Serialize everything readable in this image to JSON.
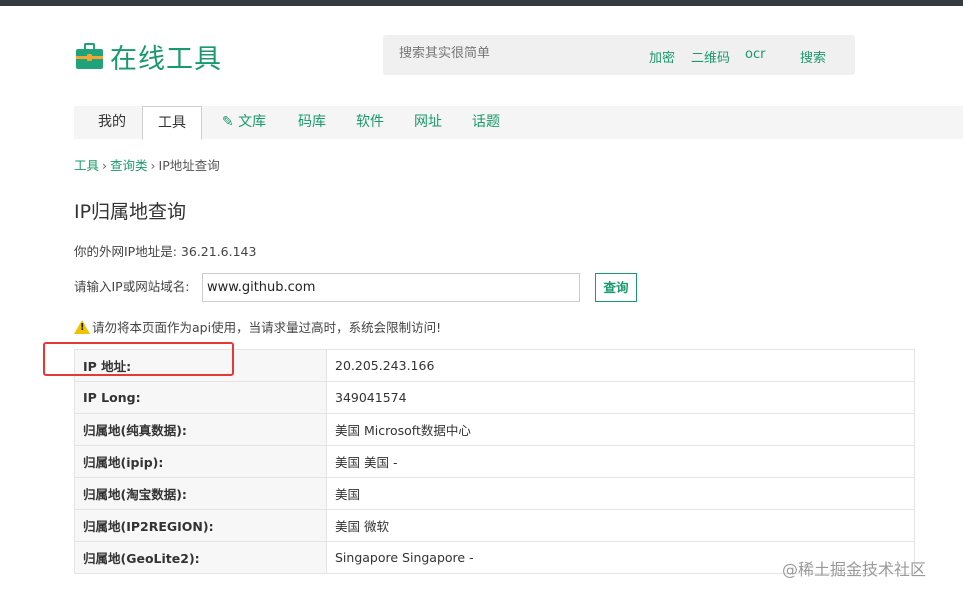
{
  "header": {
    "logo_text": "在线工具",
    "search_placeholder": "搜索其实很简单",
    "search_tags": [
      "加密",
      "二维码",
      "ocr"
    ],
    "search_button": "搜索"
  },
  "nav": {
    "tabs": [
      {
        "label": "我的"
      },
      {
        "label": "工具"
      },
      {
        "label": "文库"
      },
      {
        "label": "码库"
      },
      {
        "label": "软件"
      },
      {
        "label": "网址"
      },
      {
        "label": "话题"
      }
    ]
  },
  "breadcrumb": {
    "items": [
      "工具",
      "查询类",
      "IP地址查询"
    ],
    "separator": "›"
  },
  "page": {
    "title": "IP归属地查询",
    "my_ip_text": "你的外网IP地址是: 36.21.6.143",
    "query_label": "请输入IP或网站域名:",
    "query_value": "www.github.com",
    "query_button": "查询",
    "warning_text": "请勿将本页面作为api使用，当请求量过高时，系统会限制访问!"
  },
  "results": [
    {
      "key": "IP 地址:",
      "value": "20.205.243.166"
    },
    {
      "key": "IP Long:",
      "value": "349041574"
    },
    {
      "key": "归属地(纯真数据):",
      "value": "美国 Microsoft数据中心"
    },
    {
      "key": "归属地(ipip):",
      "value": "美国 美国 -"
    },
    {
      "key": "归属地(淘宝数据):",
      "value": "美国"
    },
    {
      "key": "归属地(IP2REGION):",
      "value": "美国 微软"
    },
    {
      "key": "归属地(GeoLite2):",
      "value": "Singapore Singapore -"
    }
  ],
  "watermark": "@稀土掘金技术社区",
  "colors": {
    "accent": "#1a9a6c",
    "highlight": "#e53935",
    "warning": "#f2c200"
  }
}
